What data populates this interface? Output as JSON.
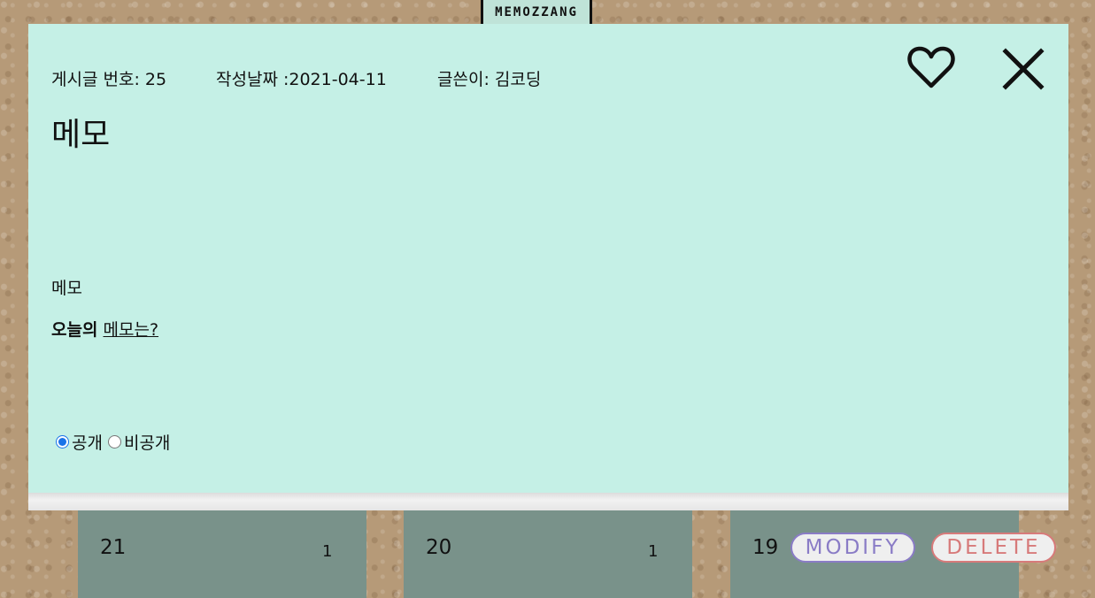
{
  "brand": {
    "logo_text": "MEMOZZANG"
  },
  "post": {
    "number_label": "게시글 번호: 25",
    "date_label": "작성날짜 :2021-04-11",
    "author_label": "글쓴이: 김코딩",
    "title": "메모",
    "body_line": "메모",
    "body_bold": "오늘의",
    "body_link": "메모는?",
    "visibility": {
      "options": [
        "공개",
        "비공개"
      ],
      "selected": "공개"
    }
  },
  "icons": {
    "like": "heart-icon",
    "close": "close-icon"
  },
  "cards": [
    {
      "number": "21",
      "count": "1"
    },
    {
      "number": "20",
      "count": "1"
    },
    {
      "number": "19",
      "modify_label": "MODIFY",
      "delete_label": "DELETE"
    }
  ],
  "colors": {
    "modal_bg": "#c5f0e6",
    "card_bg": "#79928a",
    "modify": "#8a7cc6",
    "delete": "#d77a7a"
  }
}
